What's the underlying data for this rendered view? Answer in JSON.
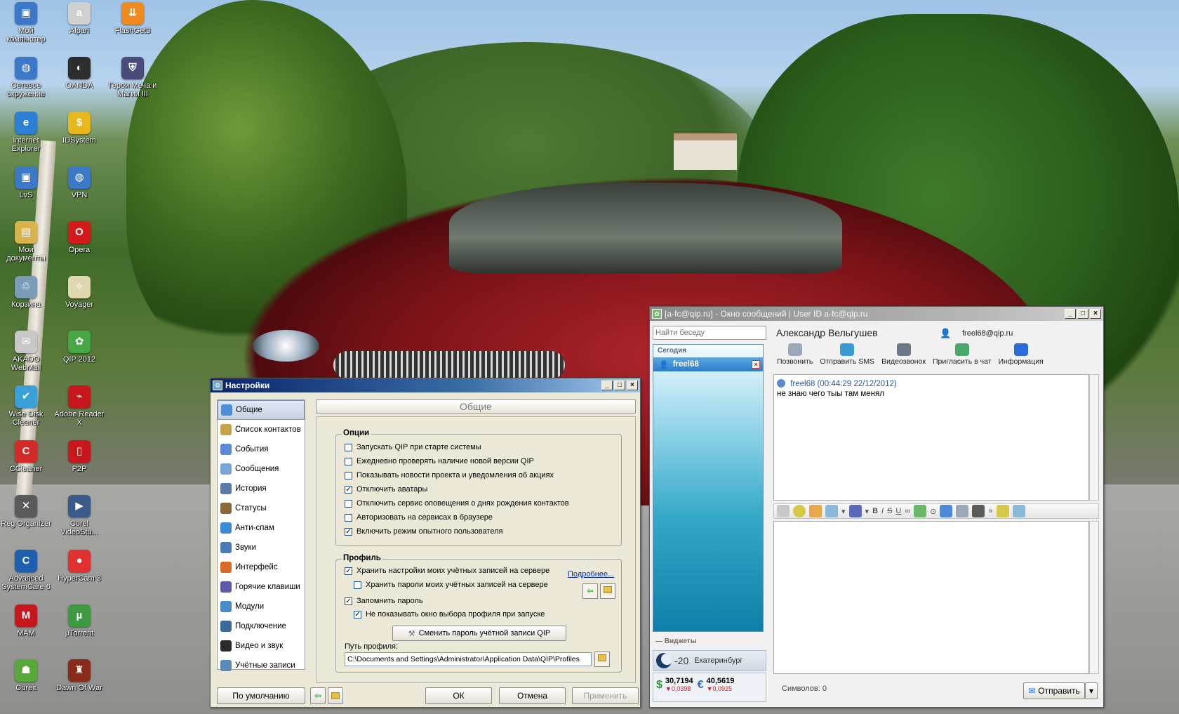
{
  "desktop": {
    "icons": [
      {
        "label": "Мой\nкомпьютер",
        "glyph": "▣",
        "color": "#3b78c8"
      },
      {
        "label": "Alpari",
        "glyph": "a",
        "color": "#d0d0d0"
      },
      {
        "label": "FlashGet3",
        "glyph": "⇊",
        "color": "#f08a1e"
      },
      {
        "label": "Сетевое\nокружение",
        "glyph": "◍",
        "color": "#3b78c8"
      },
      {
        "label": "OANDA",
        "glyph": "◐",
        "color": "#2d2d2d"
      },
      {
        "label": "Герои Меча и\nМагии III",
        "glyph": "⛨",
        "color": "#4b4b7a"
      },
      {
        "label": "Internet\nExplorer",
        "glyph": "e",
        "color": "#2a7fd4"
      },
      {
        "label": "IDSystem",
        "glyph": "$",
        "color": "#e6b81e"
      },
      {
        "label": "LvS",
        "glyph": "▣",
        "color": "#3b78c8"
      },
      {
        "label": "VPN",
        "glyph": "◍",
        "color": "#3b78c8"
      },
      {
        "label": "Мои\nдокументы",
        "glyph": "▤",
        "color": "#d8b24a"
      },
      {
        "label": "Opera",
        "glyph": "O",
        "color": "#d41a1a"
      },
      {
        "label": "Корзина",
        "glyph": "♲",
        "color": "#7a9cb8"
      },
      {
        "label": "Voyager",
        "glyph": "✧",
        "color": "#e0d8b0"
      },
      {
        "label": "AKADO\nWebMail",
        "glyph": "✉",
        "color": "#c8c8c8"
      },
      {
        "label": "QIP 2012",
        "glyph": "✿",
        "color": "#45a845"
      },
      {
        "label": "Wise Disk\nCleaner",
        "glyph": "✔",
        "color": "#3aa0d8"
      },
      {
        "label": "Adobe Reader\nX",
        "glyph": "⌁",
        "color": "#c8161d"
      },
      {
        "label": "CCleaner",
        "glyph": "C",
        "color": "#d42a2a"
      },
      {
        "label": "P2P",
        "glyph": "▯",
        "color": "#c8161d"
      },
      {
        "label": "Reg Organizer",
        "glyph": "✕",
        "color": "#5a5a5a"
      },
      {
        "label": "Corel\nVideoStu...",
        "glyph": "▶",
        "color": "#3a5a8a"
      },
      {
        "label": "Advanced\nSystemCare 6",
        "glyph": "C",
        "color": "#1f5fb0"
      },
      {
        "label": "HyperCam 3",
        "glyph": "●",
        "color": "#e23030"
      },
      {
        "label": "MAM",
        "glyph": "M",
        "color": "#c8161d"
      },
      {
        "label": "µTorrent",
        "glyph": "µ",
        "color": "#3e9a3e"
      },
      {
        "label": "Cureit",
        "glyph": "☗",
        "color": "#58a83a"
      },
      {
        "label": "Dawn Of War",
        "glyph": "♜",
        "color": "#8a2a1a"
      }
    ]
  },
  "settings": {
    "title": "Настройки",
    "section_title": "Общие",
    "nav": [
      {
        "label": "Общие",
        "color": "#4b8fd8",
        "active": true
      },
      {
        "label": "Список контактов",
        "color": "#c8a24a"
      },
      {
        "label": "События",
        "color": "#5b8ad8"
      },
      {
        "label": "Сообщения",
        "color": "#7aa6d8"
      },
      {
        "label": "История",
        "color": "#5a7aa8"
      },
      {
        "label": "Статусы",
        "color": "#8a6a3a"
      },
      {
        "label": "Анти-спам",
        "color": "#3a8ad8"
      },
      {
        "label": "Звуки",
        "color": "#4a7ab8"
      },
      {
        "label": "Интерфейс",
        "color": "#d86a2a"
      },
      {
        "label": "Горячие клавиши",
        "color": "#5a5aa8"
      },
      {
        "label": "Модули",
        "color": "#4a8ac8"
      },
      {
        "label": "Подключение",
        "color": "#3a6a9a"
      },
      {
        "label": "Видео и звук",
        "color": "#2a2a2a"
      },
      {
        "label": "Учётные записи",
        "color": "#5a8ab8"
      }
    ],
    "options_label": "Опции",
    "options": [
      {
        "label": "Запускать QIP при старте системы",
        "checked": false
      },
      {
        "label": "Ежедневно проверять наличие новой версии QIP",
        "checked": false
      },
      {
        "label": "Показывать новости проекта и уведомления об акциях",
        "checked": false
      },
      {
        "label": "Отключить аватары",
        "checked": true
      },
      {
        "label": "Отключить сервис оповещения о днях рождения контактов",
        "checked": false
      },
      {
        "label": "Авторизовать на сервисах в браузере",
        "checked": false
      },
      {
        "label": "Включить режим опытного пользователя",
        "checked": true
      }
    ],
    "profile_label": "Профиль",
    "profile": {
      "store_settings": "Хранить настройки моих учётных записей на сервере",
      "store_passwords": "Хранить пароли моих учётных записей на сервере",
      "more_link": "Подробнее...",
      "remember_password": "Запомнить пароль",
      "hide_profile_window": "Не показывать окно выбора профиля при запуске",
      "change_password_button": "Сменить пароль учётной записи QIP",
      "path_label": "Путь профиля:",
      "path_value": "C:\\Documents and Settings\\Administrator\\Application Data\\QIP\\Profiles"
    },
    "buttons": {
      "default": "По умолчанию",
      "ok": "ОК",
      "cancel": "Отмена",
      "apply": "Применить"
    }
  },
  "messenger": {
    "title": "[a-fc@qip.ru] - Окно сообщений | User ID a-fc@qip.ru",
    "search_placeholder": "Найти беседу",
    "today_label": "Сегодия",
    "contact": "freel68",
    "widgets_label": "Виджеты",
    "weather": {
      "temp": "-20",
      "city": "Екатеринбург"
    },
    "rates": [
      {
        "value": "30,7194",
        "change": "▼0,0398",
        "symbol": "$"
      },
      {
        "value": "40,5619",
        "change": "▼0,0925",
        "symbol": "€"
      }
    ],
    "chat_name": "Александр Вельгушев",
    "chat_email": "freel68@qip.ru",
    "actions": [
      {
        "label": "Позвонить",
        "color": "#9aa8b8"
      },
      {
        "label": "Отправить SMS",
        "color": "#3a9ad8"
      },
      {
        "label": "Видеозвонок",
        "color": "#6a7a8a"
      },
      {
        "label": "Пригласить в чат",
        "color": "#4aa86a"
      },
      {
        "label": "Информация",
        "color": "#2a6ad8"
      }
    ],
    "message": {
      "header": "freel68 (00:44:29 22/12/2012)",
      "text": "не знаю чего тыы там менял"
    },
    "chars_label": "Символов:",
    "chars_count": "0",
    "send_button": "Отправить"
  }
}
